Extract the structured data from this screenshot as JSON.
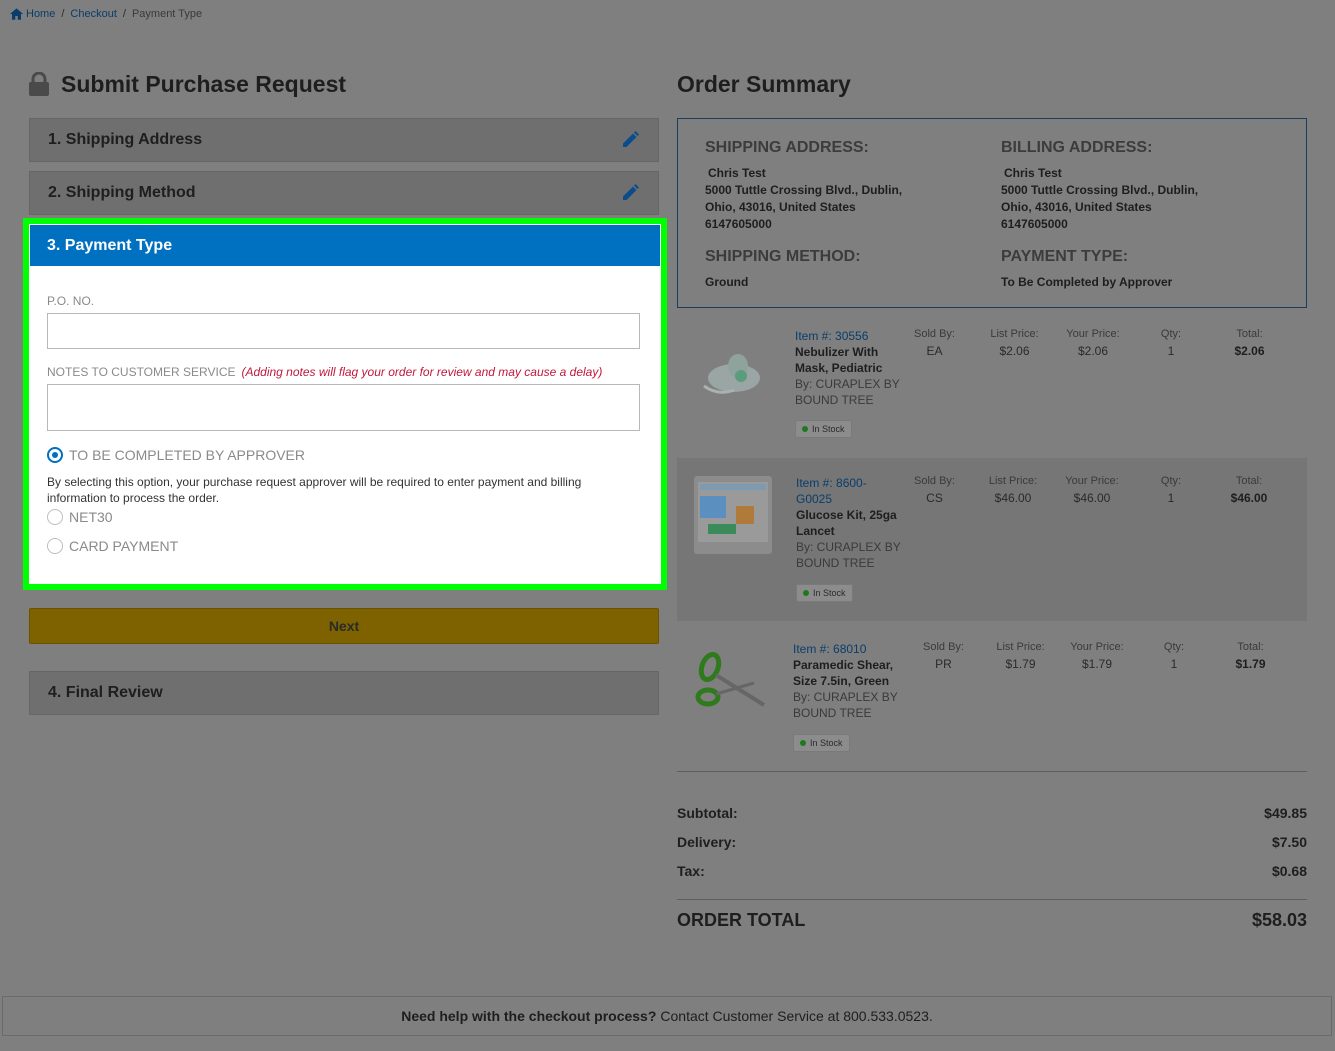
{
  "breadcrumb": {
    "home": "Home",
    "sep": "/",
    "checkout": "Checkout",
    "current": "Payment Type"
  },
  "checkout": {
    "title": "Submit Purchase Request",
    "steps": {
      "shipping_address": "1. Shipping Address",
      "shipping_method": "2. Shipping Method",
      "payment_type": "3. Payment Type",
      "final_review": "4. Final Review"
    },
    "payment": {
      "po_label": "P.O. NO.",
      "po_value": "",
      "notes_label": "NOTES TO CUSTOMER SERVICE",
      "notes_warning": "(Adding notes will flag your order for review and may cause a delay)",
      "notes_value": "",
      "options": {
        "approver": "TO BE COMPLETED BY APPROVER",
        "approver_desc": "By selecting this option, your purchase request approver will be required to enter payment and billing information to process the order.",
        "net30": "NET30",
        "card": "CARD PAYMENT"
      },
      "selected": "approver"
    },
    "next_label": "Next"
  },
  "summary": {
    "title": "Order Summary",
    "shipping_address_heading": "SHIPPING ADDRESS:",
    "billing_address_heading": "BILLING ADDRESS:",
    "shipping": {
      "name": "Chris Test",
      "line1": "5000 Tuttle Crossing Blvd.,  Dublin,",
      "line2": "Ohio,  43016,  United States",
      "phone": "6147605000"
    },
    "billing": {
      "name": "Chris Test",
      "line1": "5000 Tuttle Crossing Blvd.,  Dublin,",
      "line2": "Ohio,  43016,  United States",
      "phone": "6147605000"
    },
    "shipping_method_heading": "SHIPPING METHOD:",
    "shipping_method": "Ground",
    "payment_type_heading": "PAYMENT TYPE:",
    "payment_type": "To Be Completed by Approver",
    "col_headers": {
      "sold_by": "Sold By:",
      "list_price": "List Price:",
      "your_price": "Your Price:",
      "qty": "Qty:",
      "total": "Total:"
    },
    "items": [
      {
        "item_num": "Item #: 30556",
        "name_1": "Nebulizer With",
        "name_2": "Mask, Pediatric",
        "by_1": "By: CURAPLEX BY",
        "by_2": "BOUND TREE",
        "sold_by": "EA",
        "list_price": "$2.06",
        "your_price": "$2.06",
        "qty": "1",
        "total": "$2.06",
        "stock": "In Stock"
      },
      {
        "item_num_1": "Item #: 8600-",
        "item_num_2": "G0025",
        "name_1": "Glucose Kit, 25ga",
        "name_2": "Lancet",
        "by_1": "By: CURAPLEX BY",
        "by_2": "BOUND TREE",
        "sold_by": "CS",
        "list_price": "$46.00",
        "your_price": "$46.00",
        "qty": "1",
        "total": "$46.00",
        "stock": "In Stock"
      },
      {
        "item_num": "Item #: 68010",
        "name_1": "Paramedic Shear,",
        "name_2": "Size 7.5in, Green",
        "by_1": "By: CURAPLEX BY",
        "by_2": "BOUND TREE",
        "sold_by": "PR",
        "list_price": "$1.79",
        "your_price": "$1.79",
        "qty": "1",
        "total": "$1.79",
        "stock": "In Stock"
      }
    ],
    "totals": {
      "subtotal_label": "Subtotal:",
      "subtotal": "$49.85",
      "delivery_label": "Delivery:",
      "delivery": "$7.50",
      "tax_label": "Tax:",
      "tax": "$0.68",
      "order_total_label": "ORDER TOTAL",
      "order_total": "$58.03"
    }
  },
  "footer": {
    "bold": "Need help with the checkout process?",
    "text": "Contact Customer Service at 800.533.0523."
  },
  "colors": {
    "accent": "#0070c0",
    "highlight": "#00ff00",
    "warning": "#c0183c",
    "next_button": "#7e6200"
  },
  "icons": {
    "home": "home-icon",
    "lock": "lock-icon",
    "edit": "pencil-icon"
  }
}
